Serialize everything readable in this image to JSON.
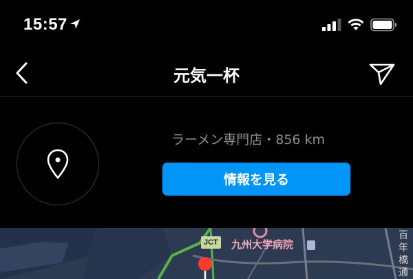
{
  "status_bar": {
    "time": "15:57",
    "icons": [
      "location-arrow-icon",
      "cellular-signal-icon",
      "wifi-icon",
      "battery-icon"
    ]
  },
  "header": {
    "back_icon": "chevron-left-icon",
    "title": "元気一杯",
    "share_icon": "paper-plane-icon"
  },
  "location": {
    "pin_icon": "location-pin-icon",
    "subtitle": "ラーメン専門店・856 km",
    "info_button_label": "情報を見る"
  },
  "map": {
    "jct_label": "JCT",
    "hospital_label": "九州大学病院",
    "street_label": "百年橋通り",
    "colors": {
      "water": "#23314a",
      "land": "#2c3a52",
      "road": "#55b34a",
      "marker": "#ff3b30"
    }
  },
  "colors": {
    "accent": "#0095f6",
    "background": "#000000",
    "muted_text": "#8e8e8e"
  }
}
